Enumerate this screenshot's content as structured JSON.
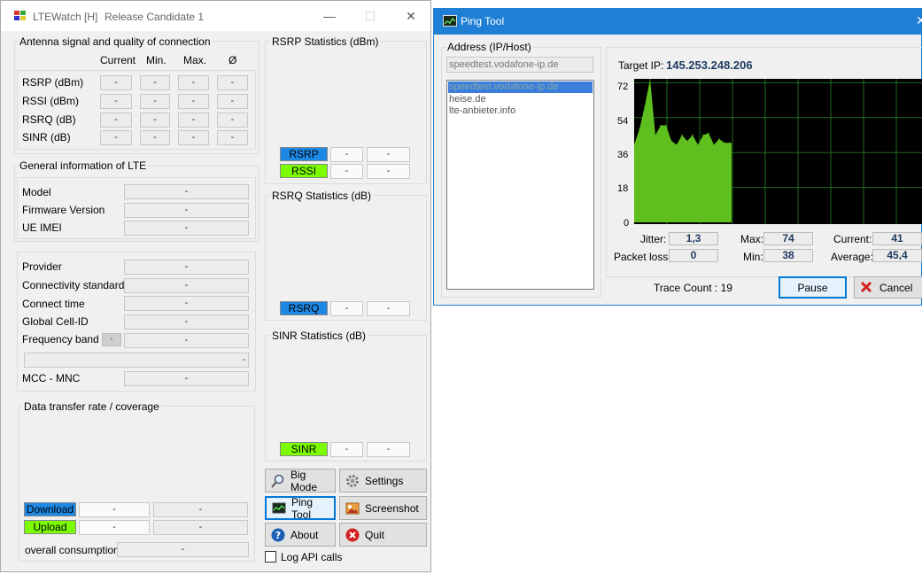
{
  "left_window": {
    "app_name": "LTEWatch [H]",
    "release": "Release Candidate 1",
    "antenna": {
      "title": "Antenna signal and quality of connection",
      "cols": [
        "Current",
        "Min.",
        "Max.",
        "Ø"
      ],
      "rows": [
        {
          "label": "RSRP (dBm)",
          "vals": [
            "-",
            "-",
            "-",
            "-"
          ]
        },
        {
          "label": "RSSI (dBm)",
          "vals": [
            "-",
            "-",
            "-",
            "-"
          ]
        },
        {
          "label": "RSRQ (dB)",
          "vals": [
            "-",
            "-",
            "-",
            "-"
          ]
        },
        {
          "label": "SINR (dB)",
          "vals": [
            "-",
            "-",
            "-",
            "-"
          ]
        }
      ]
    },
    "general": {
      "title": "General information of LTE",
      "model": "Model",
      "firmware": "Firmware Version",
      "imei": "UE IMEI",
      "dash": "-"
    },
    "provider": {
      "provider": "Provider",
      "connectivity": "Connectivity standard",
      "connect_time": "Connect time",
      "cell_id": "Global Cell-ID",
      "frequency": "Frequency band",
      "mcc": "MCC - MNC",
      "dash": "-"
    },
    "transfer": {
      "title": "Data transfer rate / coverage",
      "download": "Download",
      "upload": "Upload",
      "overall": "overall consumption",
      "dash": "-"
    },
    "rsrp_stats": {
      "title": "RSRP Statistics (dBm)",
      "rsrp": "RSRP",
      "rssi": "RSSI",
      "dash": "-"
    },
    "rsrq_stats": {
      "title": "RSRQ Statistics (dB)",
      "rsrq": "RSRQ",
      "dash": "-"
    },
    "sinr_stats": {
      "title": "SINR Statistics (dB)",
      "sinr": "SINR",
      "dash": "-"
    },
    "buttons": {
      "big_mode": "Big Mode",
      "settings": "Settings",
      "ping_tool": "Ping Tool",
      "screenshot": "Screenshot",
      "about": "About",
      "quit": "Quit"
    },
    "log_api": "Log API calls",
    "colors": {
      "blue": "#1e88e5",
      "green": "#7cfc00"
    }
  },
  "ping_window": {
    "title": "Ping Tool",
    "address_label": "Address (IP/Host)",
    "address_value": "speedtest.vodafone-ip.de",
    "hosts": [
      "speedtest.vodafone-ip.de",
      "heise.de",
      "lte-anbieter.info"
    ],
    "target_label": "Target IP:",
    "target_ip": "145.253.248.206",
    "stats": {
      "jitter_label": "Jitter:",
      "jitter": "1,3",
      "packet_loss_label": "Packet loss:",
      "packet_loss": "0",
      "max_label": "Max:",
      "max": "74",
      "min_label": "Min:",
      "min": "38",
      "current_label": "Current:",
      "current": "41",
      "average_label": "Average:",
      "average": "45,4"
    },
    "trace_count": "Trace Count : 19",
    "pause": "Pause",
    "cancel": "Cancel"
  },
  "chart_data": {
    "type": "area",
    "y_ticks": [
      "72",
      "54",
      "36",
      "18",
      "0"
    ],
    "ylim": [
      0,
      74
    ],
    "x": [
      1,
      2,
      3,
      4,
      5,
      6,
      7,
      8,
      9,
      10,
      11,
      12,
      13,
      14,
      15,
      16,
      17,
      18,
      19
    ],
    "values": [
      40,
      48,
      60,
      74,
      45,
      50,
      50,
      42,
      40,
      45,
      42,
      45,
      40,
      45,
      46,
      40,
      43,
      41,
      41
    ],
    "grid": true,
    "fill_color": "#5fbf1f",
    "background": "#000000"
  }
}
